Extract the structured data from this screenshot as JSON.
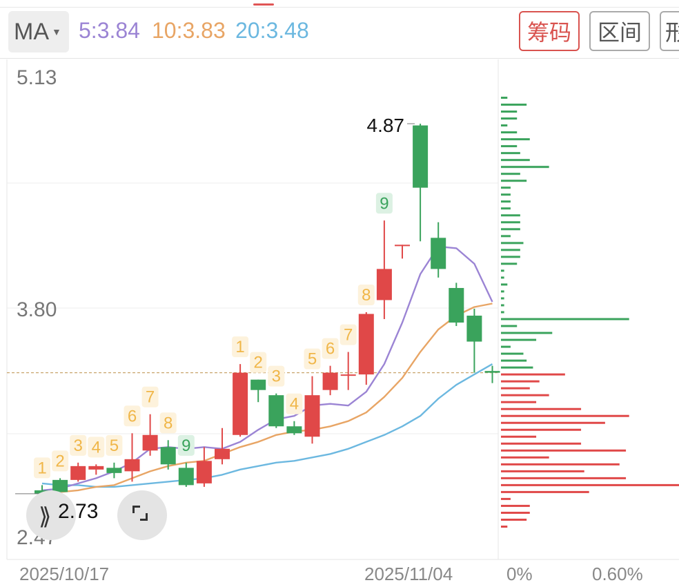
{
  "toolbar": {
    "ma_label": "MA",
    "ma5": "5:3.84",
    "ma10": "10:3.83",
    "ma20": "20:3.48",
    "btn_chips": "筹码",
    "btn_range": "区间",
    "btn_form": "形",
    "ma_button_icon": "chevron-down-icon"
  },
  "axis": {
    "y_top": "5.13",
    "y_mid": "3.80",
    "y_bottom": "2.47",
    "x_left": "2025/10/17",
    "x_right": "2025/11/04",
    "pct_left": "0%",
    "pct_right": "0.60%"
  },
  "annotations": {
    "high_label": "4.87",
    "low_label": "2.73"
  },
  "controls": {
    "scroll_icon": "double-chevron-right-icon",
    "fullscreen_icon": "fullscreen-corners-icon"
  },
  "colors": {
    "up": "#e04848",
    "down": "#3aa35c",
    "ma5": "#9b84d4",
    "ma10": "#e8a565",
    "ma20": "#6cb8e0",
    "seq_count": "#f0b648",
    "seq_bg": "#fdf2dc",
    "seq_peak": "#3aa35c"
  },
  "chart_data": {
    "type": "candlestick",
    "ylim": [
      2.47,
      5.13
    ],
    "candles": [
      {
        "o": 2.75,
        "h": 2.78,
        "l": 2.71,
        "c": 2.73
      },
      {
        "o": 2.81,
        "h": 2.82,
        "l": 2.73,
        "c": 2.74
      },
      {
        "o": 2.81,
        "h": 2.91,
        "l": 2.8,
        "c": 2.89
      },
      {
        "o": 2.87,
        "h": 2.9,
        "l": 2.84,
        "c": 2.89
      },
      {
        "o": 2.88,
        "h": 2.91,
        "l": 2.82,
        "c": 2.85
      },
      {
        "o": 2.86,
        "h": 3.08,
        "l": 2.8,
        "c": 2.93
      },
      {
        "o": 2.98,
        "h": 3.19,
        "l": 2.95,
        "c": 3.07
      },
      {
        "o": 3.0,
        "h": 3.04,
        "l": 2.87,
        "c": 2.9
      },
      {
        "o": 2.88,
        "h": 2.91,
        "l": 2.77,
        "c": 2.78
      },
      {
        "o": 2.79,
        "h": 3.0,
        "l": 2.77,
        "c": 2.92
      },
      {
        "o": 2.93,
        "h": 3.11,
        "l": 2.9,
        "c": 2.99
      },
      {
        "o": 3.07,
        "h": 3.48,
        "l": 3.06,
        "c": 3.43
      },
      {
        "o": 3.39,
        "h": 3.39,
        "l": 3.26,
        "c": 3.33
      },
      {
        "o": 3.3,
        "h": 3.31,
        "l": 3.11,
        "c": 3.12
      },
      {
        "o": 3.12,
        "h": 3.15,
        "l": 3.07,
        "c": 3.08
      },
      {
        "o": 3.06,
        "h": 3.41,
        "l": 3.02,
        "c": 3.3
      },
      {
        "o": 3.33,
        "h": 3.47,
        "l": 3.3,
        "c": 3.43
      },
      {
        "o": 3.42,
        "h": 3.55,
        "l": 3.33,
        "c": 3.42
      },
      {
        "o": 3.42,
        "h": 3.78,
        "l": 3.36,
        "c": 3.77
      },
      {
        "o": 3.85,
        "h": 4.31,
        "l": 3.74,
        "c": 4.03
      },
      {
        "o": 4.17,
        "h": 4.17,
        "l": 4.09,
        "c": 4.17
      },
      {
        "o": 4.86,
        "h": 4.87,
        "l": 4.19,
        "c": 4.5
      },
      {
        "o": 4.21,
        "h": 4.3,
        "l": 3.98,
        "c": 4.03
      },
      {
        "o": 3.92,
        "h": 3.95,
        "l": 3.7,
        "c": 3.72
      },
      {
        "o": 3.76,
        "h": 3.8,
        "l": 3.43,
        "c": 3.61
      },
      {
        "o": 3.44,
        "h": 3.47,
        "l": 3.37,
        "c": 3.43
      }
    ],
    "ma5": [
      2.75,
      2.76,
      2.79,
      2.82,
      2.86,
      2.91,
      2.99,
      3.0,
      2.99,
      3.0,
      2.99,
      3.03,
      3.1,
      3.16,
      3.18,
      3.24,
      3.25,
      3.24,
      3.32,
      3.48,
      3.72,
      4.0,
      4.16,
      4.15,
      4.06,
      3.84
    ],
    "ma10": [
      2.74,
      2.74,
      2.75,
      2.77,
      2.78,
      2.82,
      2.86,
      2.89,
      2.91,
      2.92,
      2.96,
      3.0,
      3.03,
      3.07,
      3.09,
      3.1,
      3.12,
      3.15,
      3.2,
      3.29,
      3.4,
      3.55,
      3.68,
      3.76,
      3.81,
      3.83
    ],
    "ma20": [
      2.79,
      2.78,
      2.78,
      2.77,
      2.77,
      2.78,
      2.79,
      2.8,
      2.81,
      2.82,
      2.84,
      2.87,
      2.89,
      2.91,
      2.92,
      2.94,
      2.96,
      2.99,
      3.03,
      3.07,
      3.12,
      3.18,
      3.28,
      3.36,
      3.42,
      3.48
    ],
    "sequence_labels": [
      {
        "i": 0,
        "t": "1"
      },
      {
        "i": 1,
        "t": "2"
      },
      {
        "i": 2,
        "t": "3"
      },
      {
        "i": 3,
        "t": "4"
      },
      {
        "i": 4,
        "t": "5"
      },
      {
        "i": 5,
        "t": "6"
      },
      {
        "i": 6,
        "t": "7"
      },
      {
        "i": 7,
        "t": "8"
      },
      {
        "i": 8,
        "t": "9",
        "peak": true
      },
      {
        "i": 11,
        "t": "1"
      },
      {
        "i": 12,
        "t": "2"
      },
      {
        "i": 13,
        "t": "3"
      },
      {
        "i": 14,
        "t": "4"
      },
      {
        "i": 15,
        "t": "5"
      },
      {
        "i": 16,
        "t": "6"
      },
      {
        "i": 17,
        "t": "7"
      },
      {
        "i": 18,
        "t": "8"
      },
      {
        "i": 19,
        "t": "9",
        "peak": true
      }
    ],
    "current_price": 3.43,
    "volume_profile": {
      "prices": [
        5.02,
        4.98,
        4.94,
        4.9,
        4.86,
        4.82,
        4.78,
        4.74,
        4.7,
        4.66,
        4.62,
        4.58,
        4.54,
        4.5,
        4.46,
        4.42,
        4.38,
        4.34,
        4.3,
        4.26,
        4.22,
        4.18,
        4.14,
        4.1,
        4.06,
        4.02,
        3.98,
        3.94,
        3.9,
        3.86,
        3.82,
        3.78,
        3.74,
        3.7,
        3.66,
        3.62,
        3.58,
        3.54,
        3.5,
        3.46,
        3.42,
        3.38,
        3.34,
        3.3,
        3.26,
        3.22,
        3.18,
        3.14,
        3.1,
        3.06,
        3.02,
        2.98,
        2.94,
        2.9,
        2.86,
        2.82,
        2.78,
        2.74,
        2.7,
        2.66,
        2.62,
        2.58,
        2.54
      ],
      "share": [
        0.004,
        0.016,
        0.01,
        0.01,
        0.004,
        0.01,
        0.018,
        0.01,
        0.012,
        0.018,
        0.03,
        0.012,
        0.016,
        0.006,
        0.006,
        0.006,
        0.006,
        0.012,
        0.012,
        0.012,
        0.006,
        0.014,
        0.012,
        0.012,
        0.01,
        0.002,
        0.002,
        0.004,
        0.002,
        0.002,
        0.002,
        0.002,
        0.08,
        0.01,
        0.032,
        0.022,
        0.006,
        0.014,
        0.016,
        0.02,
        0.04,
        0.024,
        0.018,
        0.03,
        0.022,
        0.05,
        0.08,
        0.065,
        0.05,
        0.022,
        0.05,
        0.078,
        0.03,
        0.074,
        0.052,
        0.078,
        0.112,
        0.055,
        0.006,
        0.018,
        0.018,
        0.016,
        0.004
      ],
      "split_price": 3.43
    }
  }
}
